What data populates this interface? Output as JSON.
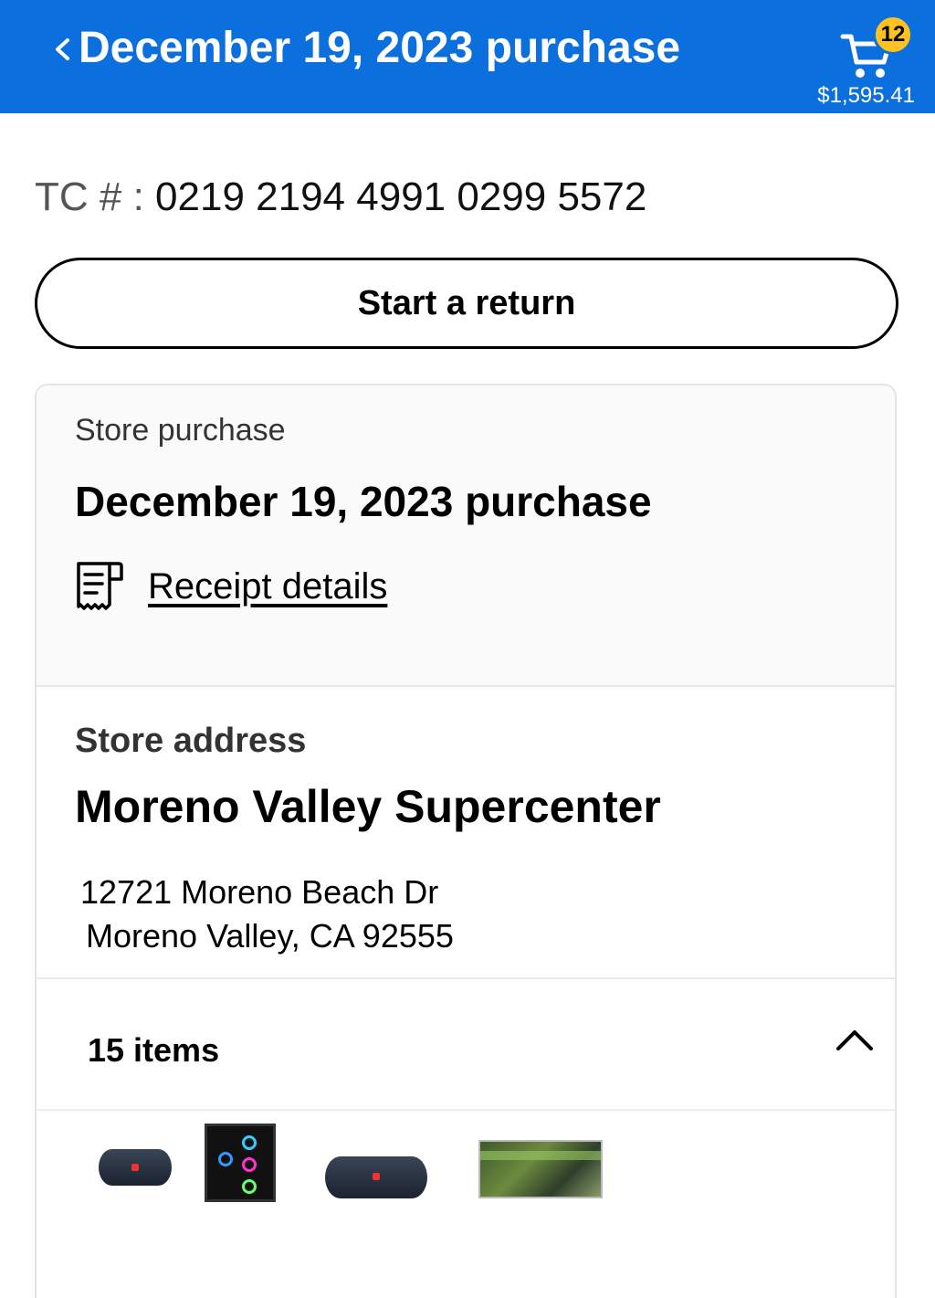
{
  "header": {
    "back_icon": "chevron-left-icon",
    "title": "December 19, 2023 purchase",
    "cart": {
      "icon": "cart-icon",
      "badge_count": "12",
      "total": "$1,595.41",
      "badge_color": "#ffc220"
    },
    "background_color": "#0b6fde"
  },
  "transaction": {
    "label": "TC # : ",
    "number": "0219 2194 4991 0299 5572"
  },
  "actions": {
    "start_return_label": "Start a return"
  },
  "purchase": {
    "type_label": "Store purchase",
    "title": "December 19, 2023 purchase",
    "receipt_icon": "receipt-icon",
    "receipt_link": "Receipt details"
  },
  "store": {
    "section_label": "Store address",
    "name": "Moreno Valley Supercenter",
    "address_line1": "12721 Moreno Beach Dr",
    "address_line2": "Moreno Valley, CA 92555"
  },
  "items": {
    "count_label": "15 items",
    "toggle_icon": "chevron-up-icon",
    "thumbnails": [
      {
        "name": "speaker-thumbnail",
        "kind": "speaker"
      },
      {
        "name": "pc-case-thumbnail",
        "kind": "pc-case"
      },
      {
        "name": "speaker-thumbnail",
        "kind": "speaker"
      },
      {
        "name": "product-box-thumbnail",
        "kind": "box"
      }
    ]
  }
}
